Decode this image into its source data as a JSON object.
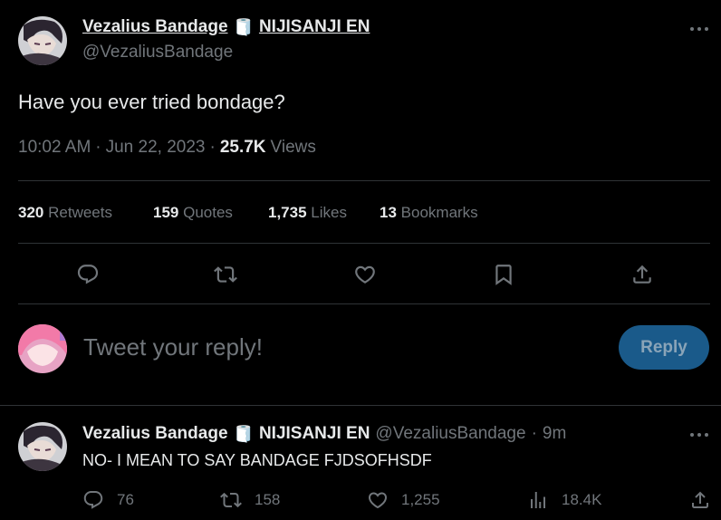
{
  "tweet": {
    "display_name": "Vezalius Bandage",
    "badge_emoji": "🧻",
    "org": "NIJISANJI EN",
    "handle": "@VezaliusBandage",
    "text": "Have you ever tried bondage?",
    "time": "10:02 AM",
    "dot": "·",
    "date": "Jun 22, 2023",
    "views_count": "25.7K",
    "views_label": "Views",
    "stats": [
      {
        "count": "320",
        "label": "Retweets"
      },
      {
        "count": "159",
        "label": "Quotes"
      },
      {
        "count": "1,735",
        "label": "Likes"
      },
      {
        "count": "13",
        "label": "Bookmarks"
      }
    ]
  },
  "composer": {
    "placeholder": "Tweet your reply!",
    "reply_label": "Reply"
  },
  "reply": {
    "display_name": "Vezalius Bandage",
    "badge_emoji": "🧻",
    "org": "NIJISANJI EN",
    "handle": "@VezaliusBandage",
    "dot": "·",
    "age": "9m",
    "text": "NO- I MEAN TO SAY BANDAGE FJDSOFHSDF",
    "actions": {
      "replies": "76",
      "retweets": "158",
      "likes": "1,255",
      "views": "18.4K"
    }
  },
  "colors": {
    "background": "#000000",
    "text": "#e7e9ea",
    "muted": "#71767b",
    "divider": "#2f3336",
    "reply_button": "#1a5a8a"
  }
}
